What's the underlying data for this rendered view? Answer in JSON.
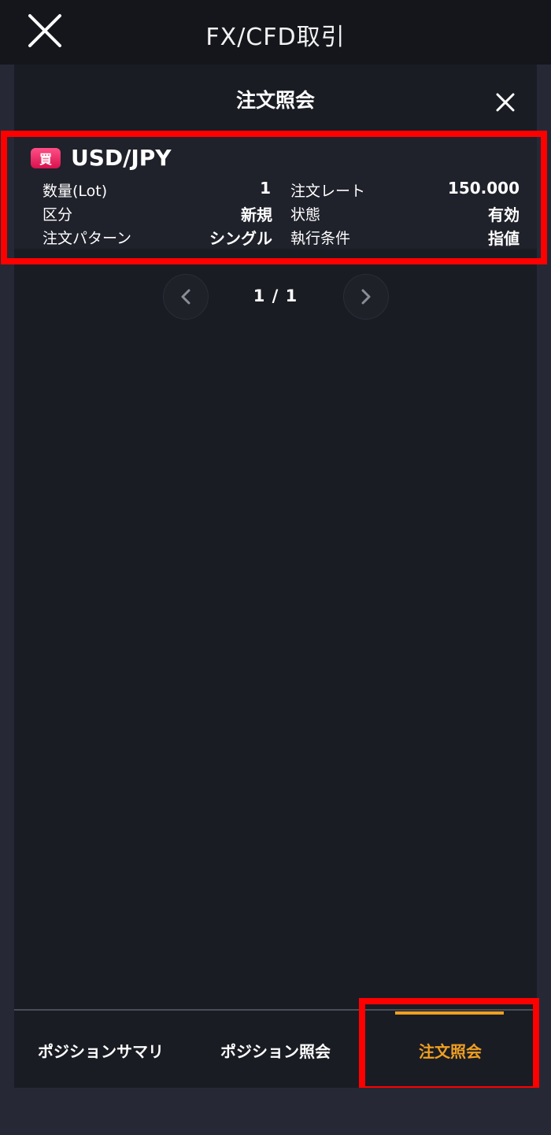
{
  "app": {
    "title": "FX/CFD取引"
  },
  "panel": {
    "title": "注文照会"
  },
  "order": {
    "side_badge": "買",
    "symbol": "USD/JPY",
    "fields": {
      "quantity_label": "数量(Lot)",
      "quantity_value": "1",
      "rate_label": "注文レート",
      "rate_value": "150.000",
      "category_label": "区分",
      "category_value": "新規",
      "status_label": "状態",
      "status_value": "有効",
      "pattern_label": "注文パターン",
      "pattern_value": "シングル",
      "condition_label": "執行条件",
      "condition_value": "指値"
    }
  },
  "pager": {
    "text": "1 / 1"
  },
  "tabs": [
    {
      "label": "ポジションサマリ",
      "active": false
    },
    {
      "label": "ポジション照会",
      "active": false
    },
    {
      "label": "注文照会",
      "active": true
    }
  ],
  "colors": {
    "background": "#262935",
    "topbar": "#14161b",
    "panel": "#1a1c24",
    "buy_badge": "#e8185a",
    "active_tab": "#f0a020",
    "highlight": "#ff0000"
  },
  "icons": {
    "top_close": "close-icon",
    "panel_close": "close-icon",
    "pager_prev": "chevron-left-icon",
    "pager_next": "chevron-right-icon"
  }
}
